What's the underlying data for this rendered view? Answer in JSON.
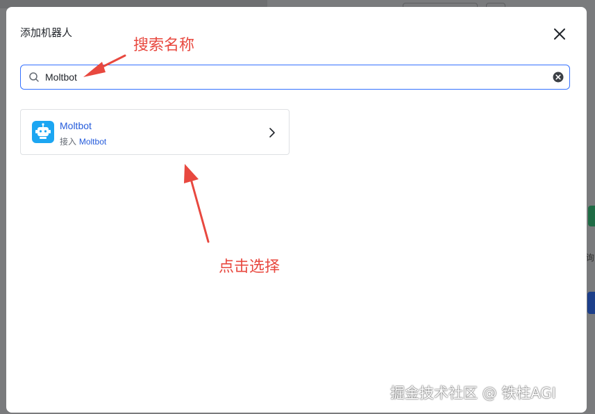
{
  "dialog": {
    "title": "添加机器人",
    "search": {
      "value": "Moltbot",
      "placeholder": ""
    },
    "results": [
      {
        "name": "Moltbot",
        "sub_prefix": "接入",
        "sub_highlight": "Moltbot",
        "icon": "robot-icon"
      }
    ]
  },
  "annotations": {
    "search_hint": "搜索名称",
    "click_hint": "点击选择"
  },
  "watermark": "掘金技术社区 @ 铁柱AGI",
  "background": {
    "side_text": "询"
  },
  "colors": {
    "accent": "#3370ff",
    "link": "#245bdb",
    "annotation": "#e8483f",
    "bot_icon_bg": "#1ca6f2"
  }
}
